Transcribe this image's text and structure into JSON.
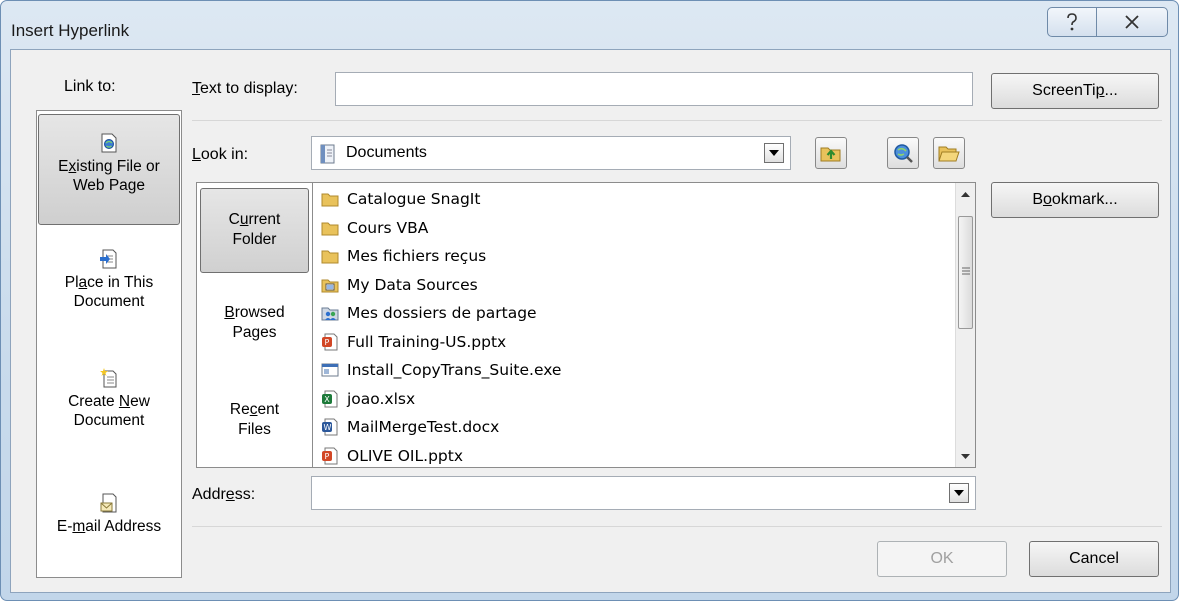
{
  "window": {
    "title": "Insert Hyperlink",
    "help_glyph": "?",
    "close_glyph": "✕"
  },
  "link_to": {
    "title": "Link to:",
    "items": [
      {
        "pre": "E",
        "u": "x",
        "post": "isting File or",
        "line2": "Web Page",
        "icon": "existing-file-icon",
        "selected": true
      },
      {
        "pre": "Pl",
        "u": "a",
        "post": "ce in This",
        "line2": "Document",
        "icon": "place-in-document-icon",
        "selected": false
      },
      {
        "pre": "Create ",
        "u": "N",
        "post": "ew",
        "line2": "Document",
        "icon": "create-new-document-icon",
        "selected": false
      },
      {
        "pre": "E-",
        "u": "m",
        "post": "ail Address",
        "line2": "",
        "icon": "email-address-icon",
        "selected": false
      }
    ]
  },
  "text_to_display": {
    "u": "T",
    "rest": "ext to display:",
    "value": ""
  },
  "screentip": {
    "pre": "ScreenTi",
    "u": "p",
    "post": "..."
  },
  "look_in": {
    "u": "L",
    "rest": "ook in:",
    "value": "Documents",
    "icon": "documents-icon"
  },
  "toolbar": {
    "up_folder_icon": "up-folder-icon",
    "browse_web_icon": "browse-web-icon",
    "browse_file_icon": "browse-file-icon"
  },
  "nav": [
    {
      "pre": "C",
      "u": "u",
      "post": "rrent",
      "line2": "Folder",
      "selected": true
    },
    {
      "pre": "",
      "u": "B",
      "post": "rowsed",
      "line2": "Pages",
      "selected": false
    },
    {
      "pre": "Re",
      "u": "c",
      "post": "ent",
      "line2": "Files",
      "selected": false
    }
  ],
  "files": [
    {
      "name": "Catalogue SnagIt",
      "icon": "folder-icon"
    },
    {
      "name": "Cours VBA",
      "icon": "folder-icon"
    },
    {
      "name": "Mes fichiers reçus",
      "icon": "folder-icon"
    },
    {
      "name": "My Data Sources",
      "icon": "data-sources-folder-icon"
    },
    {
      "name": "Mes dossiers de partage",
      "icon": "shared-folder-icon"
    },
    {
      "name": "Full Training-US.pptx",
      "icon": "powerpoint-file-icon"
    },
    {
      "name": "Install_CopyTrans_Suite.exe",
      "icon": "exe-file-icon"
    },
    {
      "name": "joao.xlsx",
      "icon": "excel-file-icon"
    },
    {
      "name": "MailMergeTest.docx",
      "icon": "word-file-icon"
    },
    {
      "name": "OLIVE OIL.pptx",
      "icon": "powerpoint-file-icon"
    }
  ],
  "bookmark": {
    "pre": "B",
    "u": "o",
    "post": "okmark..."
  },
  "address": {
    "pre": "Addr",
    "u": "e",
    "post": "ss:",
    "value": ""
  },
  "ok_label": "OK",
  "cancel_label": "Cancel",
  "colors": {
    "folder": "#e9c25b",
    "powerpoint": "#d24726",
    "excel": "#1d7a3a",
    "word": "#2b579a",
    "selection": "#d6d6d6"
  }
}
